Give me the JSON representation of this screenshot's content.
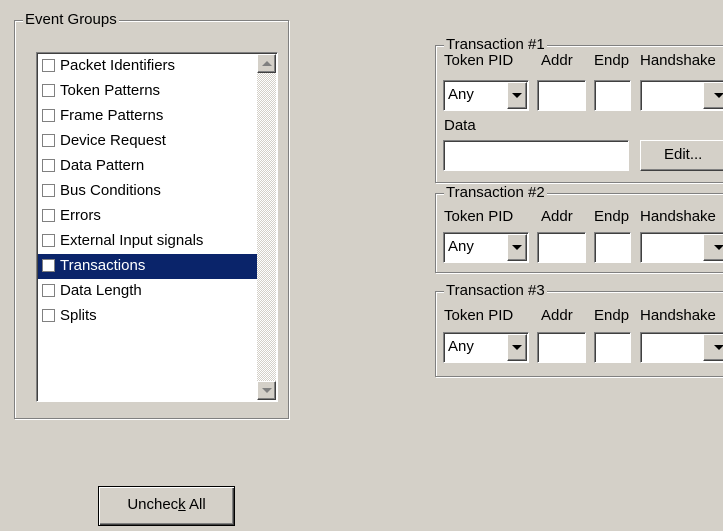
{
  "event_groups": {
    "title": "Event Groups",
    "items": [
      {
        "label": "Packet Identifiers",
        "checked": false,
        "selected": false
      },
      {
        "label": "Token Patterns",
        "checked": false,
        "selected": false
      },
      {
        "label": "Frame Patterns",
        "checked": false,
        "selected": false
      },
      {
        "label": "Device Request",
        "checked": false,
        "selected": false
      },
      {
        "label": "Data Pattern",
        "checked": false,
        "selected": false
      },
      {
        "label": "Bus Conditions",
        "checked": false,
        "selected": false
      },
      {
        "label": "Errors",
        "checked": false,
        "selected": false
      },
      {
        "label": "External Input signals",
        "checked": false,
        "selected": false
      },
      {
        "label": "Transactions",
        "checked": false,
        "selected": true
      },
      {
        "label": "Data Length",
        "checked": false,
        "selected": false
      },
      {
        "label": "Splits",
        "checked": false,
        "selected": false
      }
    ]
  },
  "uncheck_all": {
    "prefix": "Unchec",
    "accel": "k",
    "suffix": " All"
  },
  "transactions": [
    {
      "title": "Transaction #1",
      "token_pid_label": "Token PID",
      "addr_label": "Addr",
      "endp_label": "Endp",
      "handshake_label": "Handshake",
      "token_pid_value": "Any",
      "addr_value": "",
      "endp_value": "",
      "handshake_value": "",
      "data_label": "Data",
      "data_value": "",
      "edit_label": "Edit..."
    },
    {
      "title": "Transaction #2",
      "token_pid_label": "Token PID",
      "addr_label": "Addr",
      "endp_label": "Endp",
      "handshake_label": "Handshake",
      "token_pid_value": "Any",
      "addr_value": "",
      "endp_value": "",
      "handshake_value": ""
    },
    {
      "title": "Transaction #3",
      "token_pid_label": "Token PID",
      "addr_label": "Addr",
      "endp_label": "Endp",
      "handshake_label": "Handshake",
      "token_pid_value": "Any",
      "addr_value": "",
      "endp_value": "",
      "handshake_value": ""
    }
  ],
  "colors": {
    "background": "#d4d0c8",
    "selection": "#0a246a"
  }
}
